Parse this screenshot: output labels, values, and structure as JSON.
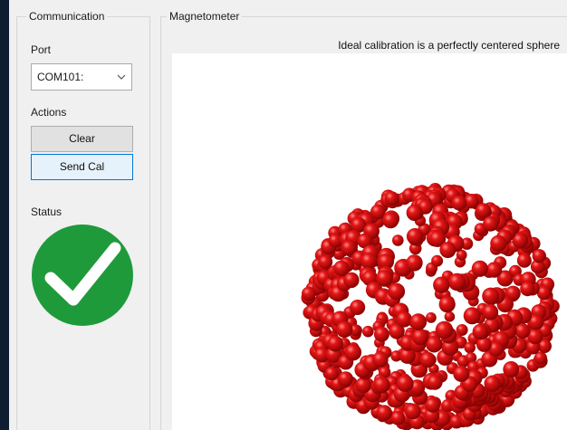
{
  "communication": {
    "title": "Communication",
    "port_label": "Port",
    "port_value": "COM101:",
    "actions_label": "Actions",
    "clear_label": "Clear",
    "send_cal_label": "Send Cal",
    "status_label": "Status",
    "status_state": "ok",
    "status_color": "#1f9a3a"
  },
  "magnetometer": {
    "title": "Magnetometer",
    "caption": "Ideal calibration is a perfectly centered sphere",
    "point_color": "#e00000"
  },
  "icons": [
    "chevron-down-icon",
    "checkmark-icon"
  ]
}
